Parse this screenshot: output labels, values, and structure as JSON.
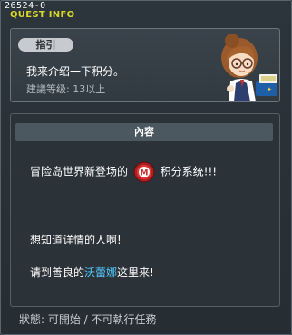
{
  "quest_id": "26524-0",
  "title": "QUEST INFO",
  "guide": {
    "tag": "指引",
    "text": "我来介绍一下积分。",
    "level": "建議等级: 13以上"
  },
  "content": {
    "header": "內容",
    "line1_before": "冒险岛世界新登场的",
    "line1_after": "积分系统!!!",
    "line2": "想知道详情的人啊!",
    "line3_before": "请到善良的",
    "npc_name": "沃蕾娜",
    "line3_after": "这里来!"
  },
  "status": "狀態: 可開始 / 不可執行任務",
  "colors": {
    "title": "#d8d82a",
    "npc_name": "#53ccff",
    "coin": "#c8302c"
  },
  "icons": {
    "npc": "npc-portrait-icon",
    "coin": "maple-point-coin-icon"
  }
}
